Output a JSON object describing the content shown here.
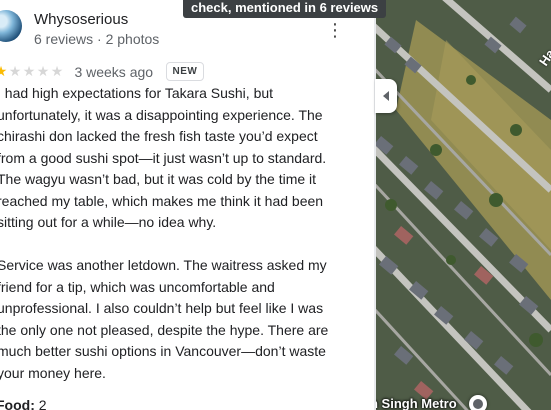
{
  "tooltip": {
    "text": "check, mentioned in 6 reviews"
  },
  "review": {
    "reviewer_name": "Whysoserious",
    "reviewer_meta": "6 reviews · 2 photos",
    "more_icon": "more-vert-icon",
    "rating": 1,
    "rating_max": 5,
    "date": "3 weeks ago",
    "badge": "NEW",
    "paragraph1": "I had high expectations for Takara Sushi, but unfortunately, it was a disappointing experience. The chirashi don lacked the fresh fish taste you’d expect from a good sushi spot—it just wasn’t up to standard. The wagyu wasn’t bad, but it was cold by the time it reached my table, which makes me think it had been sitting out for a while—no idea why.",
    "paragraph2": "Service was another letdown. The waitress asked my friend for a tip, which was uncomfortable and unprofessional. I also couldn’t help but feel like I was the only one not pleased, despite the hype. There are much better sushi options in Vancouver—don’t waste your money here.",
    "food_label": "Food:",
    "food_value": "2"
  },
  "collapse_icon": "chevron-left-icon",
  "map": {
    "road_label": "Ha",
    "place_label": "n Singh Metro",
    "pin_icon": "place-pin-icon",
    "colors": {
      "grass": "#9c9355",
      "road": "#b9b9b5",
      "roof": "#6a6f78",
      "tree": "#3f5a2e"
    }
  }
}
